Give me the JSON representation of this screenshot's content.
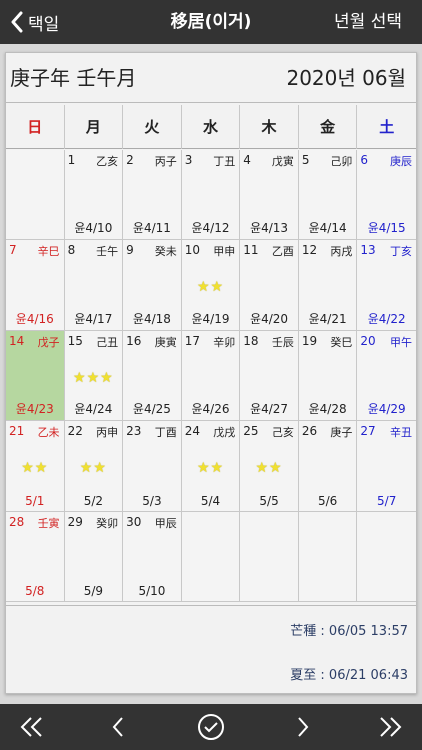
{
  "nav": {
    "back_label": "택일",
    "title": "移居(이거)",
    "right_label": "년월 선택"
  },
  "header": {
    "ganzhi": "庚子年 壬午月",
    "date": "2020년 06월"
  },
  "weekdays": [
    {
      "label": "日"
    },
    {
      "label": "月"
    },
    {
      "label": "火"
    },
    {
      "label": "水"
    },
    {
      "label": "木"
    },
    {
      "label": "金"
    },
    {
      "label": "土"
    }
  ],
  "cells": [
    {
      "day": "",
      "gz": "",
      "lunar": "",
      "stars": ""
    },
    {
      "day": "1",
      "gz": "乙亥",
      "lunar": "윤4/10",
      "stars": ""
    },
    {
      "day": "2",
      "gz": "丙子",
      "lunar": "윤4/11",
      "stars": ""
    },
    {
      "day": "3",
      "gz": "丁丑",
      "lunar": "윤4/12",
      "stars": ""
    },
    {
      "day": "4",
      "gz": "戊寅",
      "lunar": "윤4/13",
      "stars": ""
    },
    {
      "day": "5",
      "gz": "己卯",
      "lunar": "윤4/14",
      "stars": ""
    },
    {
      "day": "6",
      "gz": "庚辰",
      "lunar": "윤4/15",
      "stars": ""
    },
    {
      "day": "7",
      "gz": "辛巳",
      "lunar": "윤4/16",
      "stars": ""
    },
    {
      "day": "8",
      "gz": "壬午",
      "lunar": "윤4/17",
      "stars": ""
    },
    {
      "day": "9",
      "gz": "癸未",
      "lunar": "윤4/18",
      "stars": ""
    },
    {
      "day": "10",
      "gz": "甲申",
      "lunar": "윤4/19",
      "stars": "★★"
    },
    {
      "day": "11",
      "gz": "乙酉",
      "lunar": "윤4/20",
      "stars": ""
    },
    {
      "day": "12",
      "gz": "丙戌",
      "lunar": "윤4/21",
      "stars": ""
    },
    {
      "day": "13",
      "gz": "丁亥",
      "lunar": "윤4/22",
      "stars": ""
    },
    {
      "day": "14",
      "gz": "戊子",
      "lunar": "윤4/23",
      "stars": ""
    },
    {
      "day": "15",
      "gz": "己丑",
      "lunar": "윤4/24",
      "stars": "★★★"
    },
    {
      "day": "16",
      "gz": "庚寅",
      "lunar": "윤4/25",
      "stars": ""
    },
    {
      "day": "17",
      "gz": "辛卯",
      "lunar": "윤4/26",
      "stars": ""
    },
    {
      "day": "18",
      "gz": "壬辰",
      "lunar": "윤4/27",
      "stars": ""
    },
    {
      "day": "19",
      "gz": "癸巳",
      "lunar": "윤4/28",
      "stars": ""
    },
    {
      "day": "20",
      "gz": "甲午",
      "lunar": "윤4/29",
      "stars": ""
    },
    {
      "day": "21",
      "gz": "乙未",
      "lunar": "5/1",
      "stars": "★★"
    },
    {
      "day": "22",
      "gz": "丙申",
      "lunar": "5/2",
      "stars": "★★"
    },
    {
      "day": "23",
      "gz": "丁酉",
      "lunar": "5/3",
      "stars": ""
    },
    {
      "day": "24",
      "gz": "戊戌",
      "lunar": "5/4",
      "stars": "★★"
    },
    {
      "day": "25",
      "gz": "己亥",
      "lunar": "5/5",
      "stars": "★★"
    },
    {
      "day": "26",
      "gz": "庚子",
      "lunar": "5/6",
      "stars": ""
    },
    {
      "day": "27",
      "gz": "辛丑",
      "lunar": "5/7",
      "stars": ""
    },
    {
      "day": "28",
      "gz": "壬寅",
      "lunar": "5/8",
      "stars": ""
    },
    {
      "day": "29",
      "gz": "癸卯",
      "lunar": "5/9",
      "stars": ""
    },
    {
      "day": "30",
      "gz": "甲辰",
      "lunar": "5/10",
      "stars": ""
    },
    {
      "day": "",
      "gz": "",
      "lunar": "",
      "stars": ""
    },
    {
      "day": "",
      "gz": "",
      "lunar": "",
      "stars": ""
    },
    {
      "day": "",
      "gz": "",
      "lunar": "",
      "stars": ""
    },
    {
      "day": "",
      "gz": "",
      "lunar": "",
      "stars": ""
    }
  ],
  "solar_terms": {
    "term1": "芒種 : 06/05 13:57",
    "term2": "夏至 : 06/21 06:43"
  },
  "icons": {
    "back": "chevron-left-icon",
    "first": "double-chevron-left-icon",
    "prev": "chevron-left-icon",
    "today": "check-circle-icon",
    "next": "chevron-right-icon",
    "last": "double-chevron-right-icon"
  },
  "colors": {
    "bar": "#333333",
    "today_bg": "#b6d7a0",
    "sunday": "#d22222",
    "saturday": "#2222cc",
    "star": "#f0e030"
  }
}
